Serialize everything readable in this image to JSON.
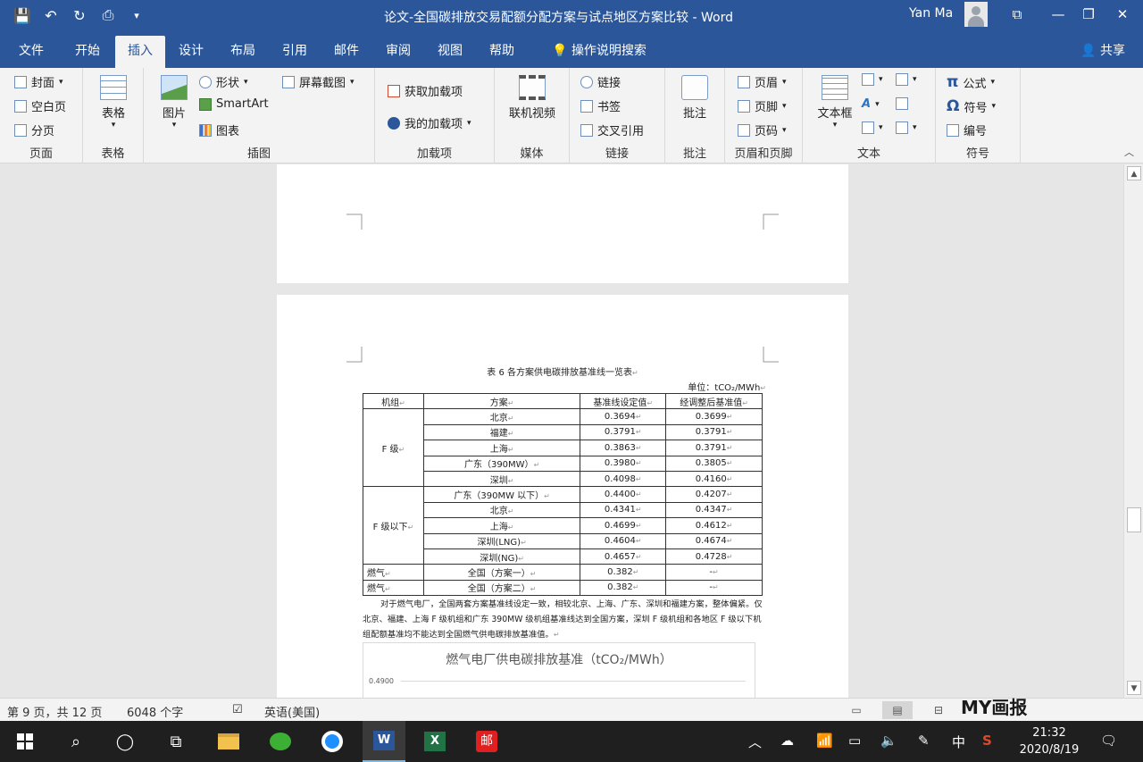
{
  "titlebar": {
    "doc_title": "论文-全国碳排放交易配额分配方案与试点地区方案比较  -  Word",
    "user": "Yan Ma",
    "qat": {
      "save": "💾",
      "undo": "↶",
      "redo": "↻",
      "preview": "⎙",
      "more": "▾"
    },
    "controls": {
      "ribbon_opts": "⧉",
      "minimize": "—",
      "restore": "❐",
      "close": "✕"
    }
  },
  "tabs": [
    "文件",
    "开始",
    "插入",
    "设计",
    "布局",
    "引用",
    "邮件",
    "审阅",
    "视图",
    "帮助"
  ],
  "tab_active": "插入",
  "search_label": "操作说明搜索",
  "share_label": "共享",
  "ribbon": {
    "pages": {
      "label": "页面",
      "cover": "封面",
      "blank": "空白页",
      "break": "分页"
    },
    "tables": {
      "label": "表格",
      "btn": "表格"
    },
    "illustrations": {
      "label": "插图",
      "picture": "图片",
      "shapes": "形状",
      "smartart": "SmartArt",
      "chart": "图表",
      "screenshot": "屏幕截图"
    },
    "addins": {
      "label": "加载项",
      "get": "获取加载项",
      "mine": "我的加载项"
    },
    "media": {
      "label": "媒体",
      "video": "联机视频"
    },
    "links": {
      "label": "链接",
      "link": "链接",
      "bookmark": "书签",
      "crossref": "交叉引用"
    },
    "comments": {
      "label": "批注",
      "btn": "批注"
    },
    "headerfooter": {
      "label": "页眉和页脚",
      "header": "页眉",
      "footer": "页脚",
      "pagenum": "页码"
    },
    "text": {
      "label": "文本",
      "textbox": "文本框"
    },
    "symbols": {
      "label": "符号",
      "equation": "公式",
      "symbol": "符号",
      "number": "编号"
    }
  },
  "document": {
    "table_caption": "表 6  各方案供电碳排放基准线一览表",
    "unit": "单位：tCO₂/MWh",
    "headers": [
      "机组",
      "方案",
      "基准线设定值",
      "经调整后基准值"
    ],
    "groups": [
      {
        "unit": "F 级",
        "rows": [
          [
            "北京",
            "0.3694",
            "0.3699"
          ],
          [
            "福建",
            "0.3791",
            "0.3791"
          ],
          [
            "上海",
            "0.3863",
            "0.3791"
          ],
          [
            "广东（390MW）",
            "0.3980",
            "0.3805"
          ],
          [
            "深圳",
            "0.4098",
            "0.4160"
          ]
        ]
      },
      {
        "unit": "F 级以下",
        "rows": [
          [
            "广东（390MW 以下）",
            "0.4400",
            "0.4207"
          ],
          [
            "北京",
            "0.4341",
            "0.4347"
          ],
          [
            "上海",
            "0.4699",
            "0.4612"
          ],
          [
            "深圳(LNG)",
            "0.4604",
            "0.4674"
          ],
          [
            "深圳(NG)",
            "0.4657",
            "0.4728"
          ]
        ]
      }
    ],
    "gas_rows": [
      [
        "燃气",
        "全国（方案一）",
        "0.382",
        "-"
      ],
      [
        "燃气",
        "全国（方案二）",
        "0.382",
        "-"
      ]
    ],
    "paragraph": "对于燃气电厂，全国两套方案基准线设定一致，相较北京、上海、广东、深圳和福建方案，整体偏紧。仅北京、福建、上海 F 级机组和广东 390MW 级机组基准线达到全国方案，深圳 F 级机组和各地区 F 级以下机组配额基准均不能达到全国燃气供电碳排放基准值。",
    "chart": {
      "title": "燃气电厂供电碳排放基准（tCO₂/MWh）",
      "ytick": "0.4900"
    }
  },
  "statusbar": {
    "page": "第 9 页，共 12 页",
    "words": "6048 个字",
    "lang": "英语(美国)",
    "watermark": "MY画报"
  },
  "taskbar": {
    "time": "21:32",
    "date": "2020/8/19",
    "ime": "中"
  }
}
